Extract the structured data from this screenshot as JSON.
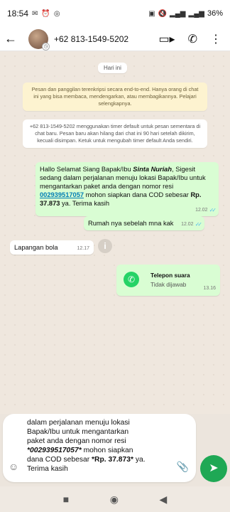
{
  "status": {
    "time": "18:54",
    "battery": "36%"
  },
  "header": {
    "contact": "+62 813-1549-5202"
  },
  "chat": {
    "date": "Hari ini",
    "encryption_notice": "Pesan dan panggilan terenkripsi secara end-to-end. Hanya orang di chat ini yang bisa membaca, mendengarkan, atau membagikannya. Pelajari selengkapnya.",
    "timer_notice": "+62 813-1549-5202 menggunakan timer default untuk pesan sementara di chat baru. Pesan baru akan hilang dari chat ini 90 hari setelah dikirim, kecuali disimpan. Ketuk untuk mengubah timer default Anda sendiri.",
    "msg1": {
      "p1": "Hallo Selamat Siang Bapak/Ibu ",
      "name": "Sinta Nuriah",
      "p2": ", Sigesit sedang dalam perjalanan menuju lokasi Bapak/Ibu untuk mengantarkan paket anda dengan nomor resi ",
      "resi": "002939517057",
      "p3": " mohon siapkan dana COD sebesar ",
      "amount": "Rp. 37.873",
      "p4": " ya. Terima kasih",
      "time": "12.02"
    },
    "msg2": {
      "text": "Rumah nya sebelah mna kak",
      "time": "12.02"
    },
    "msg3": {
      "text": "Lapangan bola",
      "time": "12.17"
    },
    "call": {
      "title": "Telepon suara",
      "subtitle": "Tidak dijawab",
      "time": "13.16"
    }
  },
  "composer": {
    "l1": "dalam perjalanan menuju lokasi",
    "l2": "Bapak/Ibu untuk mengantarkan",
    "l3": "paket anda dengan nomor resi",
    "resi": "*002939517057*",
    "l4b": " mohon siapkan",
    "l5a": "dana COD sebesar ",
    "amount": "*Rp. 37.873*",
    "l5b": " ya.",
    "l6": "Terima kasih"
  }
}
